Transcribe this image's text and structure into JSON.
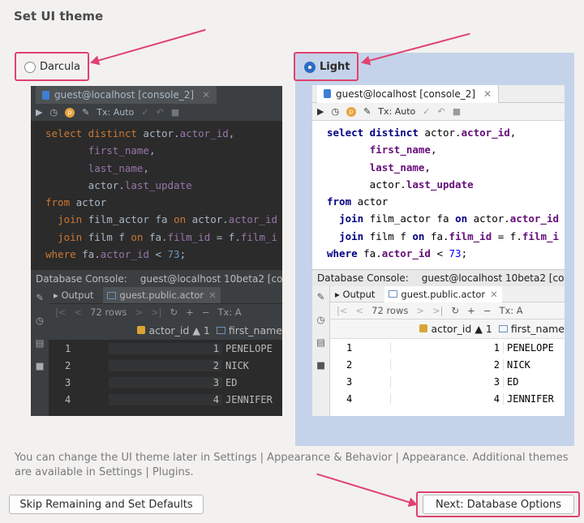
{
  "title": "Set UI theme",
  "themes": {
    "darcula": {
      "label": "Darcula",
      "selected": false
    },
    "light": {
      "label": "Light",
      "selected": true
    }
  },
  "preview": {
    "tab_title": "guest@localhost [console_2]",
    "toolbar_tx": "Tx: Auto",
    "code_lines": [
      [
        [
          "kw",
          "select distinct "
        ],
        [
          "",
          "actor."
        ],
        [
          "fld",
          "actor_id"
        ],
        [
          "",
          ","
        ]
      ],
      [
        [
          "",
          "       "
        ],
        [
          "fld",
          "first_name"
        ],
        [
          "",
          ","
        ]
      ],
      [
        [
          "",
          "       "
        ],
        [
          "fld",
          "last_name"
        ],
        [
          "",
          ","
        ]
      ],
      [
        [
          "",
          "       actor."
        ],
        [
          "fld",
          "last_update"
        ]
      ],
      [
        [
          "kw",
          "from "
        ],
        [
          "",
          "actor"
        ]
      ],
      [
        [
          "",
          "  "
        ],
        [
          "kw",
          "join "
        ],
        [
          "",
          "film_actor fa "
        ],
        [
          "kw",
          "on "
        ],
        [
          "",
          "actor."
        ],
        [
          "fld",
          "actor_id"
        ]
      ],
      [
        [
          "",
          "  "
        ],
        [
          "kw",
          "join "
        ],
        [
          "",
          "film f "
        ],
        [
          "kw",
          "on "
        ],
        [
          "",
          "fa."
        ],
        [
          "fld",
          "film_id"
        ],
        [
          "",
          " = f."
        ],
        [
          "fld",
          "film_i"
        ]
      ],
      [
        [
          "kw",
          "where "
        ],
        [
          "",
          "fa."
        ],
        [
          "fld",
          "actor_id"
        ],
        [
          "",
          " < "
        ],
        [
          "num",
          "73"
        ],
        [
          "",
          ";"
        ]
      ]
    ],
    "console_label": "Database Console:",
    "console_conn": "guest@localhost 10beta2 [co",
    "result_tabs": {
      "output": "Output",
      "table": "guest.public.actor"
    },
    "rows_label": "72 rows",
    "result_tx": "Tx: A",
    "columns": {
      "id": "actor_id",
      "id_sort": "1",
      "name": "first_name"
    },
    "rows": [
      {
        "n": "1",
        "id": "1",
        "name": "PENELOPE"
      },
      {
        "n": "2",
        "id": "2",
        "name": "NICK"
      },
      {
        "n": "3",
        "id": "3",
        "name": "ED"
      },
      {
        "n": "4",
        "id": "4",
        "name": "JENNIFER"
      }
    ]
  },
  "description": "You can change the UI theme later in Settings | Appearance & Behavior | Appearance. Additional themes are available in Settings | Plugins.",
  "buttons": {
    "skip": "Skip Remaining and Set Defaults",
    "next": "Next: Database Options"
  },
  "colors": {
    "highlight": "#e0426e",
    "selected_bg": "#c5d3ea",
    "darcula_bg": "#2b2b2b"
  }
}
